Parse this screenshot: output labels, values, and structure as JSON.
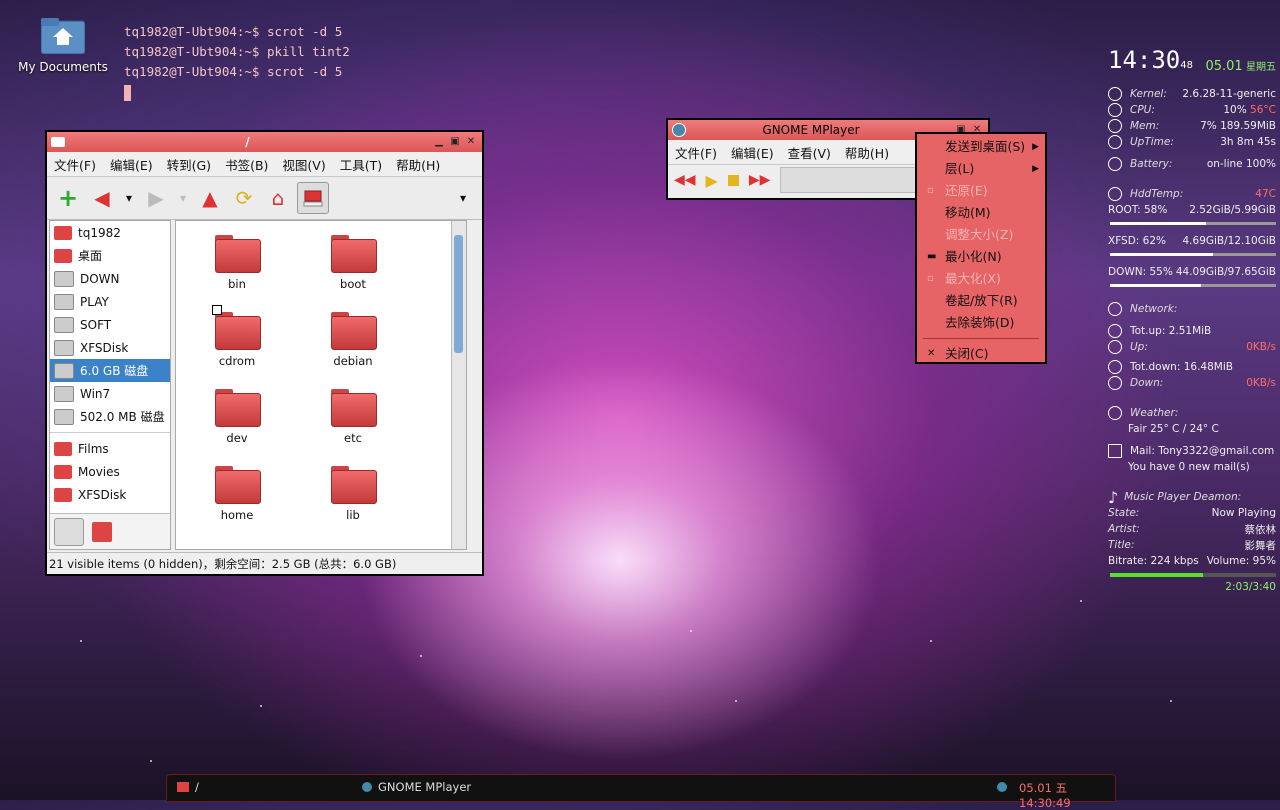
{
  "desktop": {
    "icon_label": "My Documents"
  },
  "terminal": {
    "lines": [
      "tq1982@T-Ubt904:~$ scrot -d 5",
      "tq1982@T-Ubt904:~$ pkill tint2",
      "tq1982@T-Ubt904:~$ scrot -d 5"
    ]
  },
  "file_manager": {
    "title": "/",
    "menu": [
      "文件(F)",
      "编辑(E)",
      "转到(G)",
      "书签(B)",
      "视图(V)",
      "工具(T)",
      "帮助(H)"
    ],
    "sidebar": [
      "tq1982",
      "桌面",
      "DOWN",
      "PLAY",
      "SOFT",
      "XFSDisk",
      "6.0 GB 磁盘",
      "Win7",
      "502.0 MB 磁盘",
      "Films",
      "Movies",
      "XFSDisk"
    ],
    "files": [
      "bin",
      "boot",
      "cdrom",
      "debian",
      "dev",
      "etc",
      "home",
      "lib"
    ],
    "status": "21 visible items (0 hidden)，剩余空间：2.5 GB (总共：6.0 GB)"
  },
  "mplayer": {
    "title": "GNOME MPlayer",
    "menu": [
      "文件(F)",
      "编辑(E)",
      "查看(V)",
      "帮助(H)"
    ]
  },
  "context_menu": {
    "items": [
      "发送到桌面(S)",
      "层(L)",
      "还原(E)",
      "移动(M)",
      "调整大小(Z)",
      "最小化(N)",
      "最大化(X)",
      "卷起/放下(R)",
      "去除装饰(D)",
      "关闭(C)"
    ]
  },
  "conky": {
    "time": "14:30",
    "seconds": "48",
    "date": "05.01",
    "weekday": "星期五",
    "kernel_label": "Kernel:",
    "kernel": "2.6.28-11-generic",
    "cpu_label": "CPU:",
    "cpu": "10%",
    "cpu_temp": "56°C",
    "mem_label": "Mem:",
    "mem": "7% 189.59MiB",
    "uptime_label": "UpTime:",
    "uptime": "3h 8m 45s",
    "battery_label": "Battery:",
    "battery": "on-line 100%",
    "hdd_label": "HddTemp:",
    "hdd_temp": "47C",
    "root_label": "ROOT: 58%",
    "root_val": "2.52GiB/5.99GiB",
    "root_frac": 0.58,
    "xfsd_label": "XFSD: 62%",
    "xfsd_val": "4.69GiB/12.10GiB",
    "xfsd_frac": 0.62,
    "down_label": "DOWN: 55%",
    "down_val": "44.09GiB/97.65GiB",
    "down_frac": 0.55,
    "network_label": "Network:",
    "totup": "Tot.up: 2.51MiB",
    "up_label": "Up:",
    "up": "0KB/s",
    "totdown": "Tot.down: 16.48MiB",
    "down_speed_label": "Down:",
    "down_speed": "0KB/s",
    "weather_label": "Weather:",
    "weather": "Fair 25° C / 24° C",
    "mail_label": "Mail: Tony3322@gmail.com",
    "mail_status": "You have 0 new mail(s)",
    "mpd_label": "Music Player Deamon:",
    "state_label": "State:",
    "state": "Now Playing",
    "artist_label": "Artist:",
    "artist": "蔡依林",
    "title_label": "Title:",
    "title": "影舞者",
    "bitrate": "Bitrate: 224 kbps",
    "volume": "Volume: 95%",
    "progress": "2:03/3:40",
    "progress_frac": 0.56
  },
  "taskbar": {
    "item1": "/",
    "item2": "GNOME MPlayer",
    "clock": "05.01 五 14:30:49"
  }
}
